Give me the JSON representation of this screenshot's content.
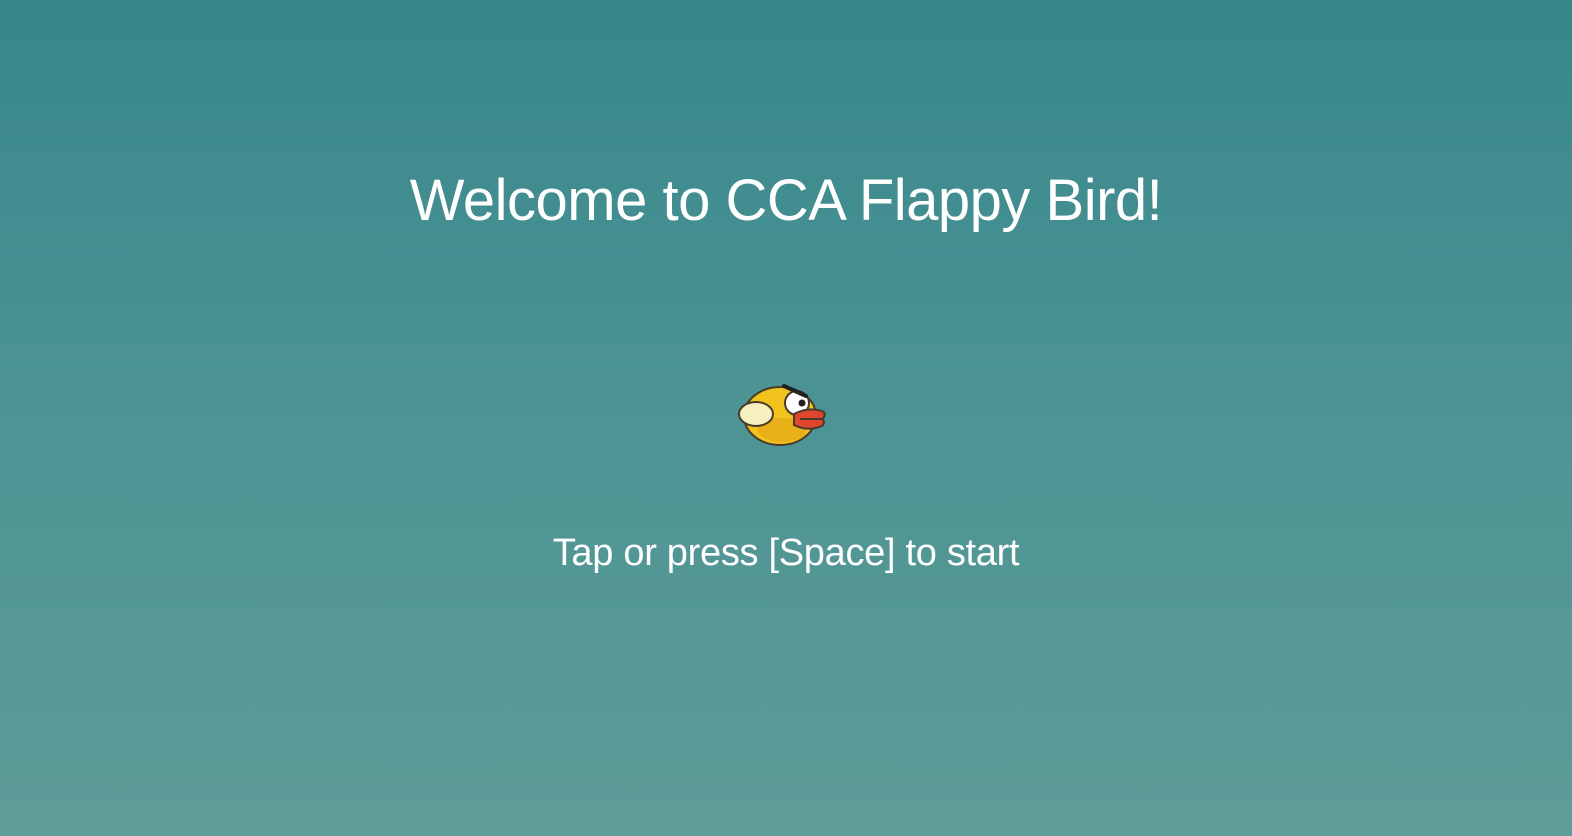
{
  "game": {
    "title": "Welcome to CCA Flappy Bird!",
    "start_prompt": "Tap or press [Space] to start",
    "sprite": "flappy-bird-icon",
    "colors": {
      "sky_top": "#37868a",
      "sky_bottom": "#5e9c97",
      "text": "#ffffff",
      "bird_body": "#f2c21d",
      "bird_beak": "#e0462e"
    }
  }
}
